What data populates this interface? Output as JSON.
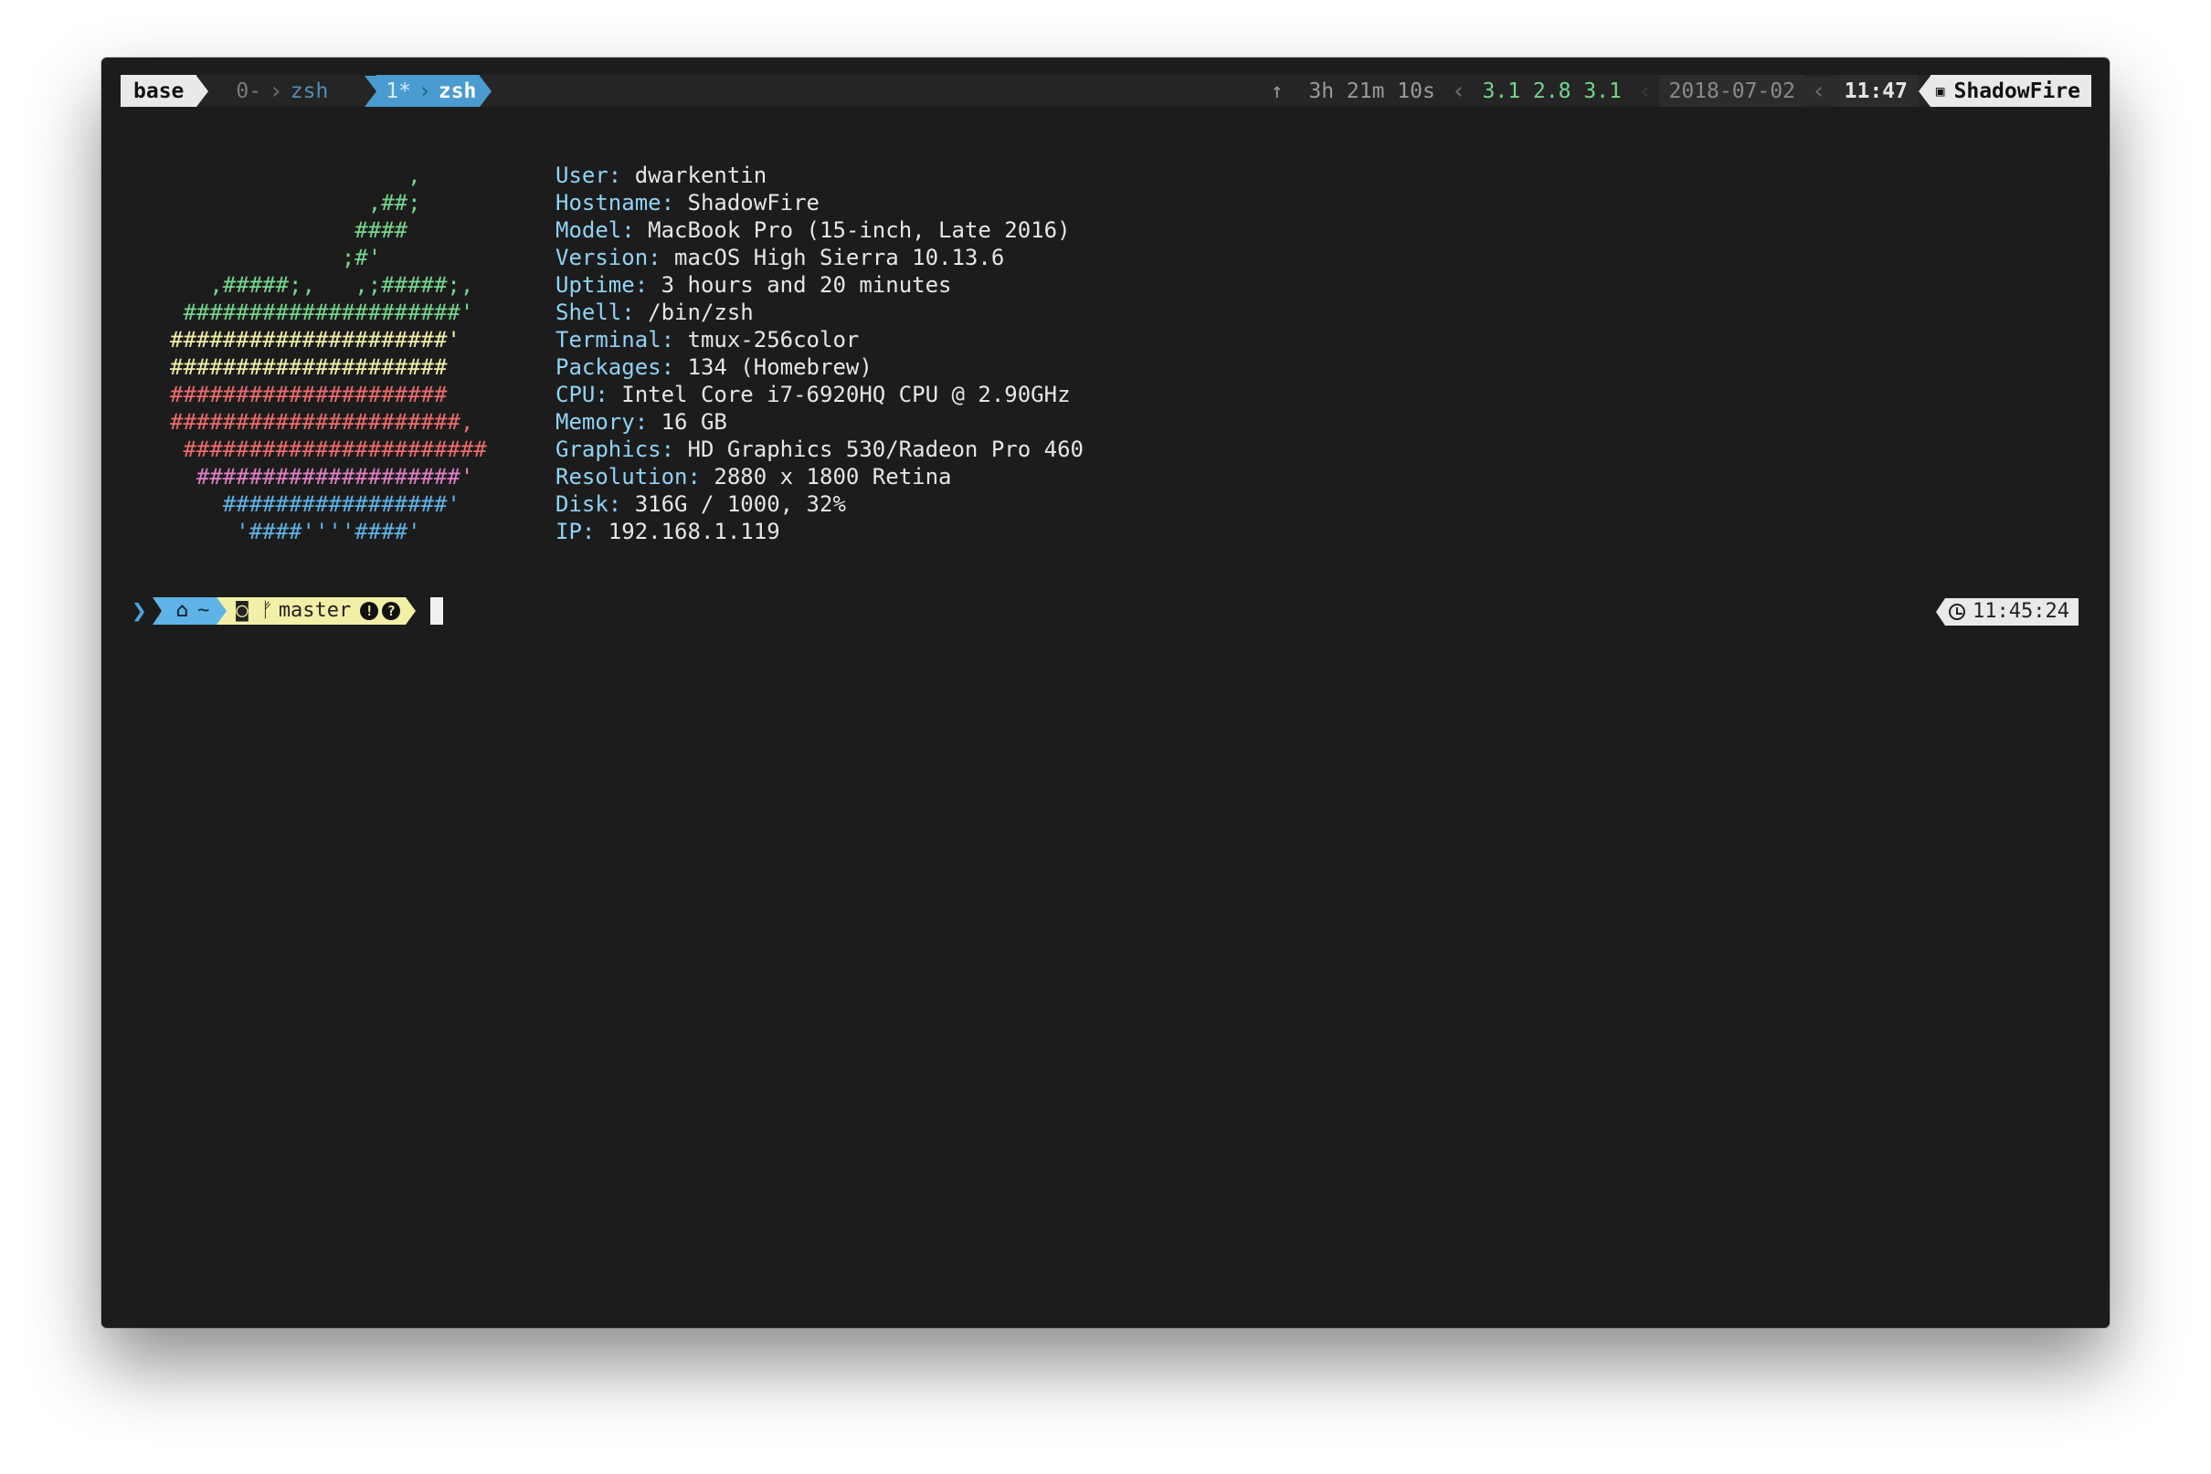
{
  "statusbar": {
    "session": "base",
    "window0": {
      "index": "0-",
      "name": "zsh"
    },
    "window1": {
      "index": "1*",
      "name": "zsh"
    },
    "uptime_arrow": "↑",
    "uptime": "3h 21m 10s",
    "load": "3.1 2.8 3.1",
    "date": "2018-07-02",
    "time": "11:47",
    "lock_icon": "🔒",
    "hostname": "ShadowFire"
  },
  "ascii_art": [
    {
      "text": "                  ,",
      "color": "#74d68b"
    },
    {
      "text": "               ,##;",
      "color": "#74d68b"
    },
    {
      "text": "              ####",
      "color": "#74d68b"
    },
    {
      "text": "             ;#'",
      "color": "#74d68b"
    },
    {
      "text": "   ,#####;,   ,;#####;,",
      "color": "#74d68b"
    },
    {
      "text": " #####################'",
      "color": "#74d68b"
    },
    {
      "text": "#####################'",
      "color": "#f2f0a6"
    },
    {
      "text": "#####################",
      "color": "#f2f0a6"
    },
    {
      "text": "#####################",
      "color": "#ef6b6b"
    },
    {
      "text": "######################,",
      "color": "#ef6b6b"
    },
    {
      "text": " #######################",
      "color": "#ef6b6b"
    },
    {
      "text": "  ####################'",
      "color": "#e07fc6"
    },
    {
      "text": "    #################'",
      "color": "#5fb3e7"
    },
    {
      "text": "     '####''''####'",
      "color": "#5fb3e7"
    }
  ],
  "info": [
    {
      "key": "User:",
      "value": " dwarkentin"
    },
    {
      "key": "Hostname:",
      "value": " ShadowFire"
    },
    {
      "key": "Model:",
      "value": " MacBook Pro (15-inch, Late 2016)"
    },
    {
      "key": "Version:",
      "value": " macOS High Sierra 10.13.6"
    },
    {
      "key": "Uptime:",
      "value": " 3 hours and 20 minutes"
    },
    {
      "key": "Shell:",
      "value": " /bin/zsh"
    },
    {
      "key": "Terminal:",
      "value": " tmux-256color"
    },
    {
      "key": "Packages:",
      "value": " 134 (Homebrew)"
    },
    {
      "key": "CPU:",
      "value": " Intel Core i7-6920HQ CPU @ 2.90GHz"
    },
    {
      "key": "Memory:",
      "value": " 16 GB"
    },
    {
      "key": "Graphics:",
      "value": " HD Graphics 530/Radeon Pro 460"
    },
    {
      "key": "Resolution:",
      "value": " 2880 x 1800 Retina"
    },
    {
      "key": "Disk:",
      "value": " 316G / 1000, 32%"
    },
    {
      "key": "IP:",
      "value": " 192.168.1.119"
    }
  ],
  "prompt": {
    "chevron": "❯",
    "home_icon": "⌂",
    "dir": "~",
    "github_icon": "🐱",
    "branch_icon": "ᚠ",
    "branch": "master",
    "badge_modified": "!",
    "badge_untracked": "?",
    "rprompt_time": "11:45:24"
  }
}
